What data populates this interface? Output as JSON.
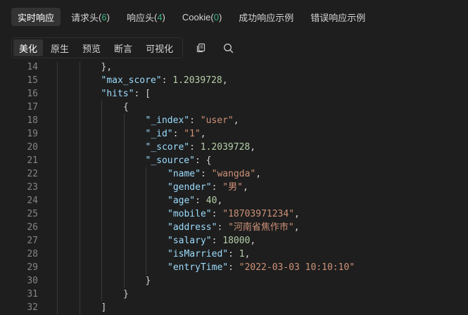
{
  "tabs": [
    {
      "label": "实时响应",
      "count": "",
      "active": true,
      "name": "tab-live-response"
    },
    {
      "label": "请求头",
      "count": "6",
      "active": false,
      "name": "tab-request-headers"
    },
    {
      "label": "响应头",
      "count": "4",
      "active": false,
      "name": "tab-response-headers"
    },
    {
      "label": "Cookie",
      "count": "0",
      "active": false,
      "name": "tab-cookie"
    },
    {
      "label": "成功响应示例",
      "count": "",
      "active": false,
      "name": "tab-success-example"
    },
    {
      "label": "错误响应示例",
      "count": "",
      "active": false,
      "name": "tab-error-example"
    }
  ],
  "view_modes": [
    {
      "label": "美化",
      "active": true,
      "name": "view-beautify"
    },
    {
      "label": "原生",
      "active": false,
      "name": "view-raw"
    },
    {
      "label": "预览",
      "active": false,
      "name": "view-preview"
    },
    {
      "label": "断言",
      "active": false,
      "name": "view-assert"
    },
    {
      "label": "可视化",
      "active": false,
      "name": "view-visualize"
    }
  ],
  "tools": [
    {
      "icon": "copy-icon",
      "name": "copy-button"
    },
    {
      "icon": "search-icon",
      "name": "search-button"
    }
  ],
  "code_lines": [
    {
      "no": "14",
      "indent": 2,
      "tokens": [
        [
          "p",
          "},"
        ]
      ]
    },
    {
      "no": "15",
      "indent": 2,
      "tokens": [
        [
          "k",
          "\"max_score\""
        ],
        [
          "p",
          ": "
        ],
        [
          "n",
          "1.2039728"
        ],
        [
          "p",
          ","
        ]
      ]
    },
    {
      "no": "16",
      "indent": 2,
      "tokens": [
        [
          "k",
          "\"hits\""
        ],
        [
          "p",
          ": ["
        ]
      ]
    },
    {
      "no": "17",
      "indent": 3,
      "tokens": [
        [
          "p",
          "{"
        ]
      ]
    },
    {
      "no": "18",
      "indent": 4,
      "tokens": [
        [
          "k",
          "\"_index\""
        ],
        [
          "p",
          ": "
        ],
        [
          "s",
          "\"user\""
        ],
        [
          "p",
          ","
        ]
      ]
    },
    {
      "no": "19",
      "indent": 4,
      "tokens": [
        [
          "k",
          "\"_id\""
        ],
        [
          "p",
          ": "
        ],
        [
          "s",
          "\"1\""
        ],
        [
          "p",
          ","
        ]
      ]
    },
    {
      "no": "20",
      "indent": 4,
      "tokens": [
        [
          "k",
          "\"_score\""
        ],
        [
          "p",
          ": "
        ],
        [
          "n",
          "1.2039728"
        ],
        [
          "p",
          ","
        ]
      ]
    },
    {
      "no": "21",
      "indent": 4,
      "tokens": [
        [
          "k",
          "\"_source\""
        ],
        [
          "p",
          ": {"
        ]
      ]
    },
    {
      "no": "22",
      "indent": 5,
      "tokens": [
        [
          "k",
          "\"name\""
        ],
        [
          "p",
          ": "
        ],
        [
          "s",
          "\"wangda\""
        ],
        [
          "p",
          ","
        ]
      ]
    },
    {
      "no": "23",
      "indent": 5,
      "tokens": [
        [
          "k",
          "\"gender\""
        ],
        [
          "p",
          ": "
        ],
        [
          "s",
          "\"男\""
        ],
        [
          "p",
          ","
        ]
      ]
    },
    {
      "no": "24",
      "indent": 5,
      "tokens": [
        [
          "k",
          "\"age\""
        ],
        [
          "p",
          ": "
        ],
        [
          "n",
          "40"
        ],
        [
          "p",
          ","
        ]
      ]
    },
    {
      "no": "25",
      "indent": 5,
      "tokens": [
        [
          "k",
          "\"mobile\""
        ],
        [
          "p",
          ": "
        ],
        [
          "s",
          "\"18703971234\""
        ],
        [
          "p",
          ","
        ]
      ]
    },
    {
      "no": "26",
      "indent": 5,
      "tokens": [
        [
          "k",
          "\"address\""
        ],
        [
          "p",
          ": "
        ],
        [
          "s",
          "\"河南省焦作市\""
        ],
        [
          "p",
          ","
        ]
      ]
    },
    {
      "no": "27",
      "indent": 5,
      "tokens": [
        [
          "k",
          "\"salary\""
        ],
        [
          "p",
          ": "
        ],
        [
          "n",
          "18000"
        ],
        [
          "p",
          ","
        ]
      ]
    },
    {
      "no": "28",
      "indent": 5,
      "tokens": [
        [
          "k",
          "\"isMarried\""
        ],
        [
          "p",
          ": "
        ],
        [
          "n",
          "1"
        ],
        [
          "p",
          ","
        ]
      ]
    },
    {
      "no": "29",
      "indent": 5,
      "tokens": [
        [
          "k",
          "\"entryTime\""
        ],
        [
          "p",
          ": "
        ],
        [
          "s",
          "\"2022-03-03 10:10:10\""
        ]
      ]
    },
    {
      "no": "30",
      "indent": 4,
      "tokens": [
        [
          "p",
          "}"
        ]
      ]
    },
    {
      "no": "31",
      "indent": 3,
      "tokens": [
        [
          "p",
          "}"
        ]
      ]
    },
    {
      "no": "32",
      "indent": 2,
      "tokens": [
        [
          "p",
          "]"
        ]
      ]
    }
  ]
}
